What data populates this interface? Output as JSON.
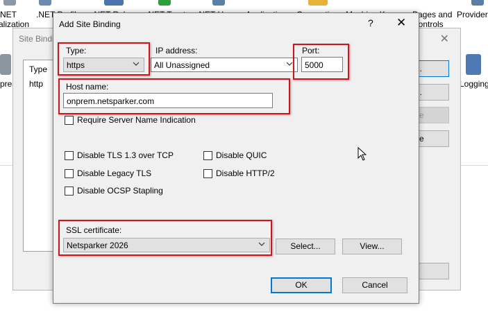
{
  "ribbon": {
    "items": [
      {
        "line1": "NET",
        "line2": "alization"
      },
      {
        "line1": ".NET Profile",
        "line2": ""
      },
      {
        "line1": ".NET Roles",
        "line2": ""
      },
      {
        "line1": ".NET Trust",
        "line2": ""
      },
      {
        "line1": ".NET Users",
        "line2": ""
      },
      {
        "line1": "Application",
        "line2": ""
      },
      {
        "line1": "Connection",
        "line2": ""
      },
      {
        "line1": "Machine Key",
        "line2": ""
      },
      {
        "line1": "Pages and",
        "line2": "Controls"
      },
      {
        "line1": "Provider",
        "line2": ""
      }
    ],
    "side_left_label": "pres",
    "side_right_label": "Logging"
  },
  "bg_window": {
    "title": "Site Bindings",
    "list_header": "Type",
    "list_row": "http",
    "buttons": [
      "...",
      "...",
      "ve",
      "se",
      "e"
    ]
  },
  "dialog": {
    "title": "Add Site Binding",
    "help_glyph": "?",
    "close_glyph": "✕",
    "type_label": "Type:",
    "type_value": "https",
    "ip_label": "IP address:",
    "ip_value": "All Unassigned",
    "port_label": "Port:",
    "port_value": "5000",
    "host_label": "Host name:",
    "host_value": "onprem.netsparker.com",
    "sni_label": "Require Server Name Indication",
    "options": [
      {
        "label": "Disable TLS 1.3 over TCP",
        "checked": false
      },
      {
        "label": "Disable QUIC",
        "checked": false
      },
      {
        "label": "Disable Legacy TLS",
        "checked": false
      },
      {
        "label": "Disable HTTP/2",
        "checked": false
      },
      {
        "label": "Disable OCSP Stapling",
        "checked": false
      }
    ],
    "ssl_label": "SSL certificate:",
    "ssl_value": "Netsparker 2026",
    "select_button": "Select...",
    "view_button": "View...",
    "ok_button": "OK",
    "cancel_button": "Cancel"
  },
  "colors": {
    "highlight": "#d0121b",
    "dialog_bg": "#f0f0f0",
    "focus_blue": "#0078d7"
  }
}
